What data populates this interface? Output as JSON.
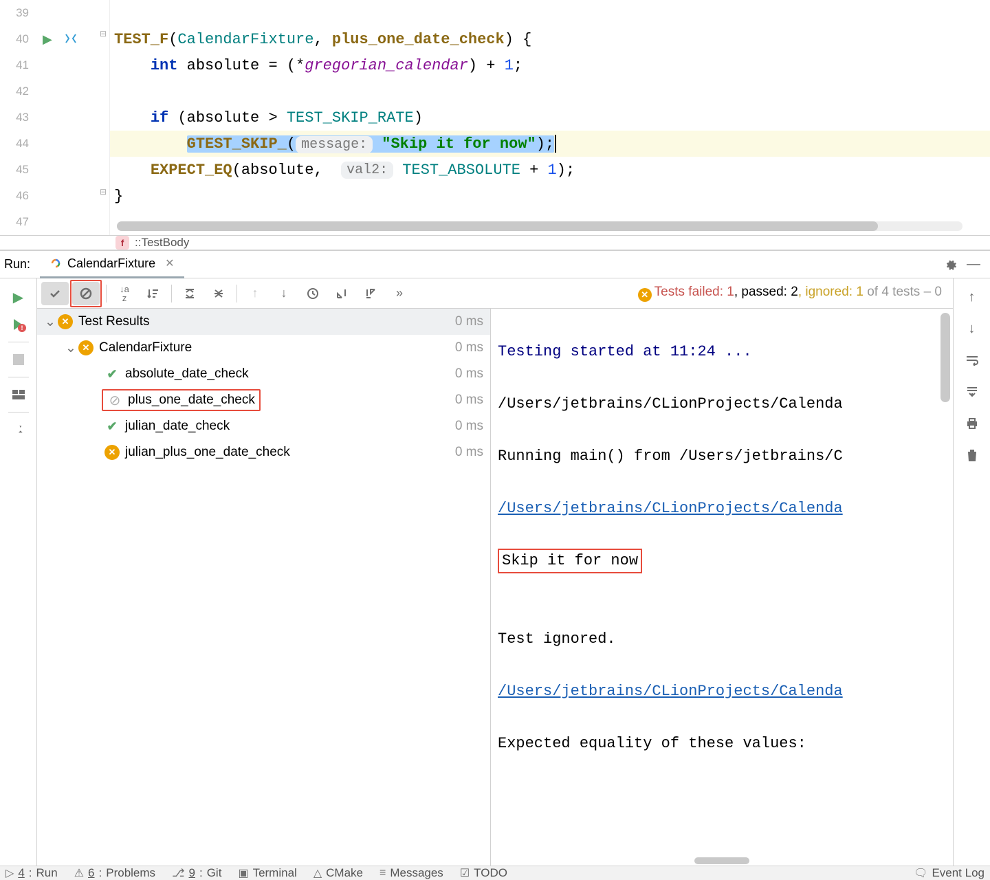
{
  "editor": {
    "lines": [
      {
        "n": 39
      },
      {
        "n": 40,
        "gutter": "run+diff"
      },
      {
        "n": 41
      },
      {
        "n": 42
      },
      {
        "n": 43
      },
      {
        "n": 44,
        "hl": true
      },
      {
        "n": 45
      },
      {
        "n": 46
      },
      {
        "n": 47
      }
    ],
    "tokens": {
      "test_f": "TEST_F",
      "calendar_fixture": "CalendarFixture",
      "plus_one": "plus_one_date_check",
      "int": "int",
      "absolute": "absolute",
      "gregorian": "gregorian_calendar",
      "plus1": "1",
      "if": "if",
      "test_skip_rate": "TEST_SKIP_RATE",
      "gtest_skip": "GTEST_SKIP_",
      "msg_hint": "message:",
      "skip_msg": "\"Skip it for now\"",
      "expect_eq": "EXPECT_EQ",
      "val2_hint": "val2:",
      "test_absolute": "TEST_ABSOLUTE"
    }
  },
  "breadcrumb": {
    "badge": "f",
    "text": "::TestBody"
  },
  "run": {
    "title": "Run:",
    "tab_name": "CalendarFixture",
    "status": {
      "label_failed": "Tests failed:",
      "failed": "1",
      "label_passed": ", passed:",
      "passed": "2",
      "label_ignored": ", ignored:",
      "ignored": "1",
      "suffix": "of 4 tests – 0"
    },
    "tree": {
      "root": {
        "name": "Test Results",
        "time": "0 ms",
        "status": "fail"
      },
      "suite": {
        "name": "CalendarFixture",
        "time": "0 ms",
        "status": "fail"
      },
      "tests": [
        {
          "name": "absolute_date_check",
          "time": "0 ms",
          "status": "pass"
        },
        {
          "name": "plus_one_date_check",
          "time": "0 ms",
          "status": "skip",
          "highlight": true
        },
        {
          "name": "julian_date_check",
          "time": "0 ms",
          "status": "pass"
        },
        {
          "name": "julian_plus_one_date_check",
          "time": "0 ms",
          "status": "fail"
        }
      ]
    },
    "console": {
      "l1": "Testing started at 11:24 ...",
      "l2": "/Users/jetbrains/CLionProjects/Calenda",
      "l3": "Running main() from /Users/jetbrains/C",
      "l4": "/Users/jetbrains/CLionProjects/Calenda",
      "l5": "Skip it for now",
      "l6": "",
      "l7": "Test ignored.",
      "l8": "/Users/jetbrains/CLionProjects/Calenda",
      "l9": "Expected equality of these values:"
    }
  },
  "statusbar": {
    "run": "Run",
    "run_key": "4",
    "problems": "Problems",
    "problems_key": "6",
    "git": "Git",
    "git_key": "9",
    "terminal": "Terminal",
    "cmake": "CMake",
    "messages": "Messages",
    "todo": "TODO",
    "event_log": "Event Log"
  }
}
